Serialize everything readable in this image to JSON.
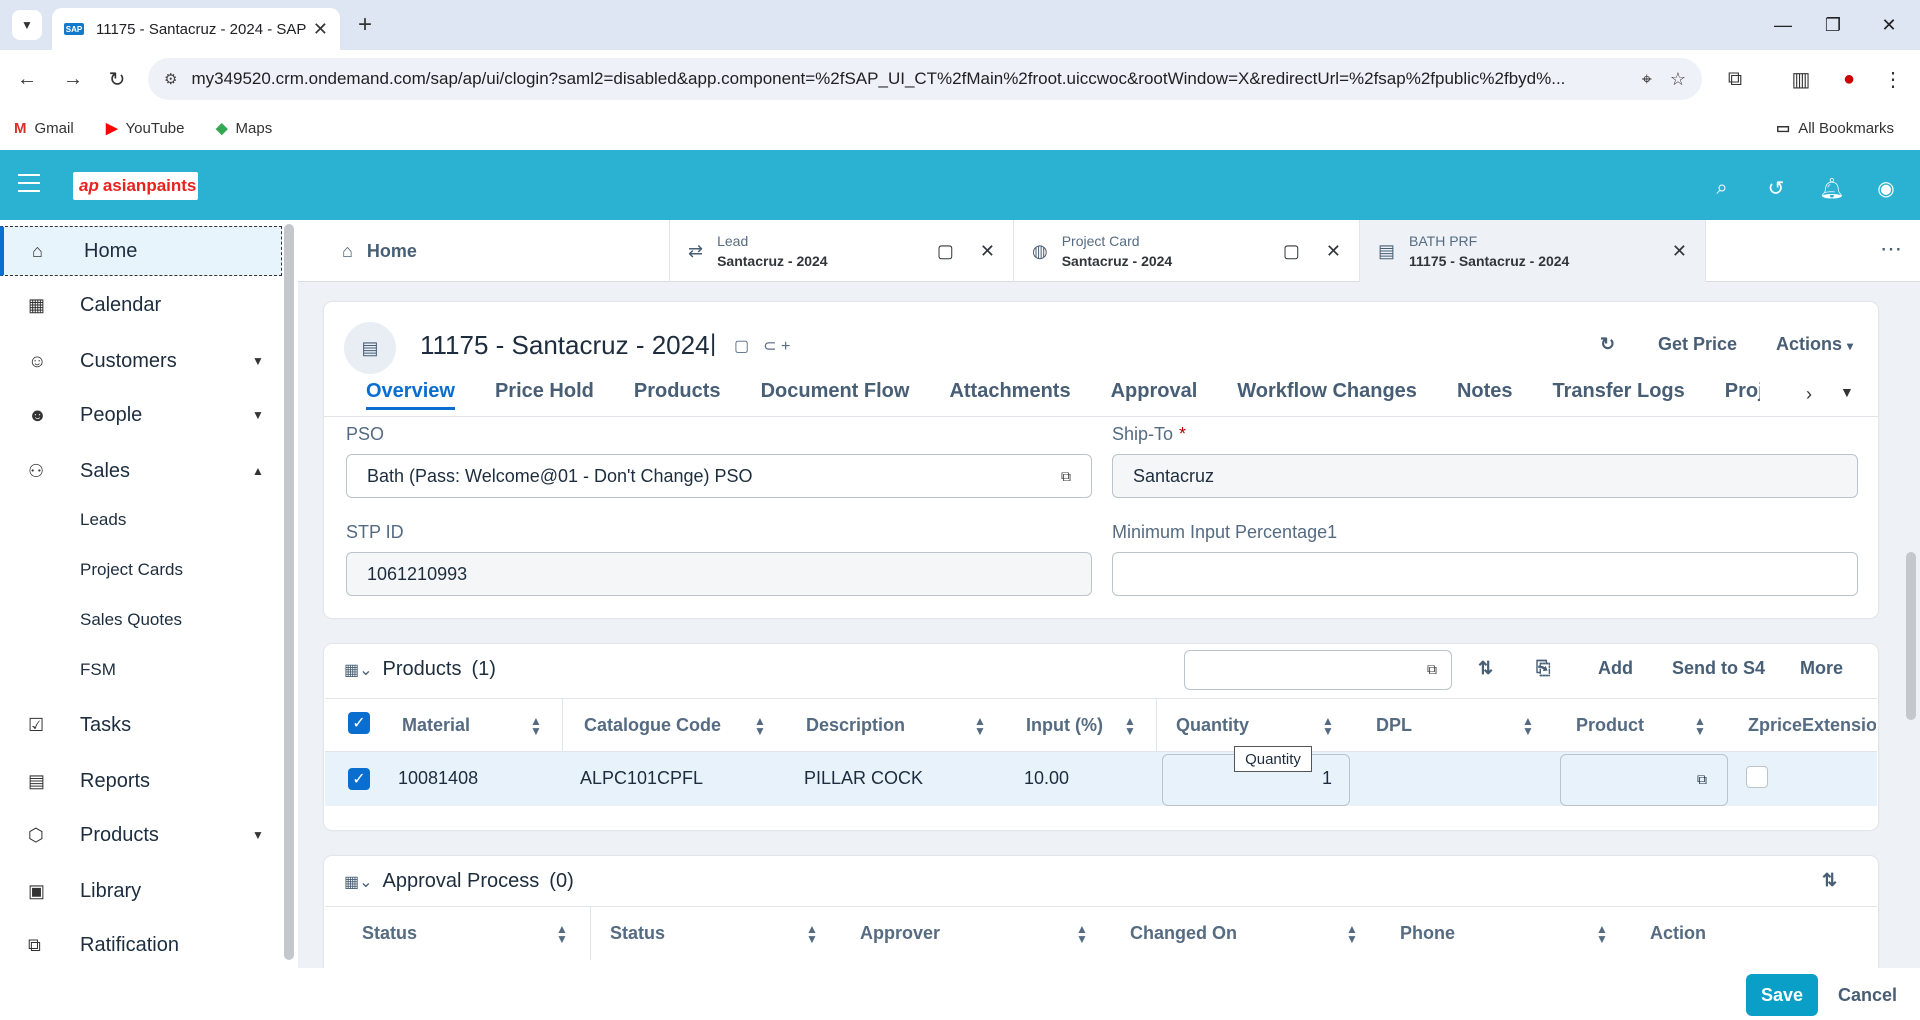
{
  "browser": {
    "tab_title": "11175 - Santacruz - 2024 - SAP",
    "url": "my349520.crm.ondemand.com/sap/ap/ui/clogin?saml2=disabled&app.component=%2fSAP_UI_CT%2fMain%2froot.uiccwoc&rootWindow=X&redirectUrl=%2fsap%2fpublic%2fbyd%...",
    "bookmarks": [
      "Gmail",
      "YouTube",
      "Maps"
    ],
    "all_bookmarks": "All Bookmarks"
  },
  "shell": {
    "logo_text": "asianpaints"
  },
  "sidebar": {
    "items": [
      {
        "label": "Home",
        "icon": "home-icon"
      },
      {
        "label": "Calendar",
        "icon": "calendar-icon"
      },
      {
        "label": "Customers",
        "icon": "customers-icon"
      },
      {
        "label": "People",
        "icon": "people-icon"
      },
      {
        "label": "Sales",
        "icon": "sales-icon"
      },
      {
        "label": "Tasks",
        "icon": "tasks-icon"
      },
      {
        "label": "Reports",
        "icon": "reports-icon"
      },
      {
        "label": "Products",
        "icon": "products-icon"
      },
      {
        "label": "Library",
        "icon": "library-icon"
      },
      {
        "label": "Ratification",
        "icon": "ratification-icon"
      }
    ],
    "sales_sub": [
      "Leads",
      "Project Cards",
      "Sales Quotes",
      "FSM"
    ]
  },
  "worktabs": {
    "home": "Home",
    "lead": {
      "type": "Lead",
      "name": "Santacruz - 2024"
    },
    "project": {
      "type": "Project Card",
      "name": "Santacruz - 2024"
    },
    "bath": {
      "type": "BATH PRF",
      "name": "11175 - Santacruz - 2024"
    }
  },
  "object": {
    "title": "11175 - Santacruz - 2024",
    "sep": "|",
    "get_price": "Get Price",
    "actions": "Actions",
    "tabs": [
      "Overview",
      "Price Hold",
      "Products",
      "Document Flow",
      "Attachments",
      "Approval",
      "Workflow Changes",
      "Notes",
      "Transfer Logs",
      "Project C"
    ]
  },
  "form": {
    "pso_label": "PSO",
    "pso_value": "Bath (Pass: Welcome@01 - Don't Change) PSO",
    "shipto_label": "Ship-To",
    "shipto_value": "Santacruz",
    "req": "*",
    "stp_label": "STP ID",
    "stp_value": "1061210993",
    "mininput_label": "Minimum Input Percentage1",
    "mininput_value": ""
  },
  "products": {
    "title": "Products",
    "count": "(1)",
    "add": "Add",
    "send": "Send to S4",
    "more": "More",
    "columns": [
      "Material",
      "Catalogue Code",
      "Description",
      "Input (%)",
      "Quantity",
      "DPL",
      "Product",
      "ZpriceExtension"
    ],
    "rows": [
      {
        "material": "10081408",
        "catalogue": "ALPC101CPFL",
        "description": "PILLAR COCK",
        "input": "10.00",
        "quantity": "1"
      }
    ],
    "tooltip": "Quantity"
  },
  "approval": {
    "title": "Approval Process",
    "count": "(0)",
    "columns": [
      "Status",
      "Status",
      "Approver",
      "Changed On",
      "Phone",
      "Action"
    ]
  },
  "footer": {
    "save": "Save",
    "cancel": "Cancel"
  }
}
